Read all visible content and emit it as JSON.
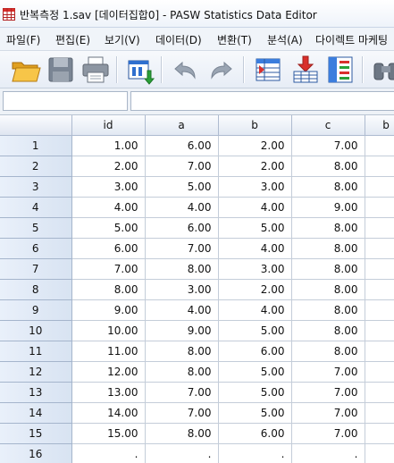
{
  "window": {
    "title": "반복측정 1.sav [데이터집합0] - PASW Statistics Data Editor"
  },
  "menu": [
    "파일(F)",
    "편집(E)",
    "보기(V)",
    "데이터(D)",
    "변환(T)",
    "분석(A)",
    "다이렉트 마케팅"
  ],
  "toolbar": {
    "buttons": [
      "open-folder-icon",
      "save-disk-icon",
      "print-icon",
      "recall-dialog-icon",
      "undo-icon",
      "redo-icon",
      "go-to-case-icon",
      "insert-cases-icon",
      "variables-icon",
      "find-binoculars-icon"
    ]
  },
  "editor": {
    "cell_ref": "",
    "cell_value": ""
  },
  "grid": {
    "columns": [
      "id",
      "a",
      "b",
      "c",
      "b"
    ],
    "rows": [
      {
        "num": "1",
        "cells": [
          "1.00",
          "6.00",
          "2.00",
          "7.00"
        ]
      },
      {
        "num": "2",
        "cells": [
          "2.00",
          "7.00",
          "2.00",
          "8.00"
        ]
      },
      {
        "num": "3",
        "cells": [
          "3.00",
          "5.00",
          "3.00",
          "8.00"
        ]
      },
      {
        "num": "4",
        "cells": [
          "4.00",
          "4.00",
          "4.00",
          "9.00"
        ]
      },
      {
        "num": "5",
        "cells": [
          "5.00",
          "6.00",
          "5.00",
          "8.00"
        ]
      },
      {
        "num": "6",
        "cells": [
          "6.00",
          "7.00",
          "4.00",
          "8.00"
        ]
      },
      {
        "num": "7",
        "cells": [
          "7.00",
          "8.00",
          "3.00",
          "8.00"
        ]
      },
      {
        "num": "8",
        "cells": [
          "8.00",
          "3.00",
          "2.00",
          "8.00"
        ]
      },
      {
        "num": "9",
        "cells": [
          "9.00",
          "4.00",
          "4.00",
          "8.00"
        ]
      },
      {
        "num": "10",
        "cells": [
          "10.00",
          "9.00",
          "5.00",
          "8.00"
        ]
      },
      {
        "num": "11",
        "cells": [
          "11.00",
          "8.00",
          "6.00",
          "8.00"
        ]
      },
      {
        "num": "12",
        "cells": [
          "12.00",
          "8.00",
          "5.00",
          "7.00"
        ]
      },
      {
        "num": "13",
        "cells": [
          "13.00",
          "7.00",
          "5.00",
          "7.00"
        ]
      },
      {
        "num": "14",
        "cells": [
          "14.00",
          "7.00",
          "5.00",
          "7.00"
        ]
      },
      {
        "num": "15",
        "cells": [
          "15.00",
          "8.00",
          "6.00",
          "7.00"
        ]
      },
      {
        "num": "16",
        "cells": [
          ".",
          ".",
          ".",
          "."
        ]
      }
    ]
  },
  "colors": {
    "row_header": "#dde7f4",
    "grid_line": "#c4cdd9",
    "title_bar": "#eef3fa"
  }
}
